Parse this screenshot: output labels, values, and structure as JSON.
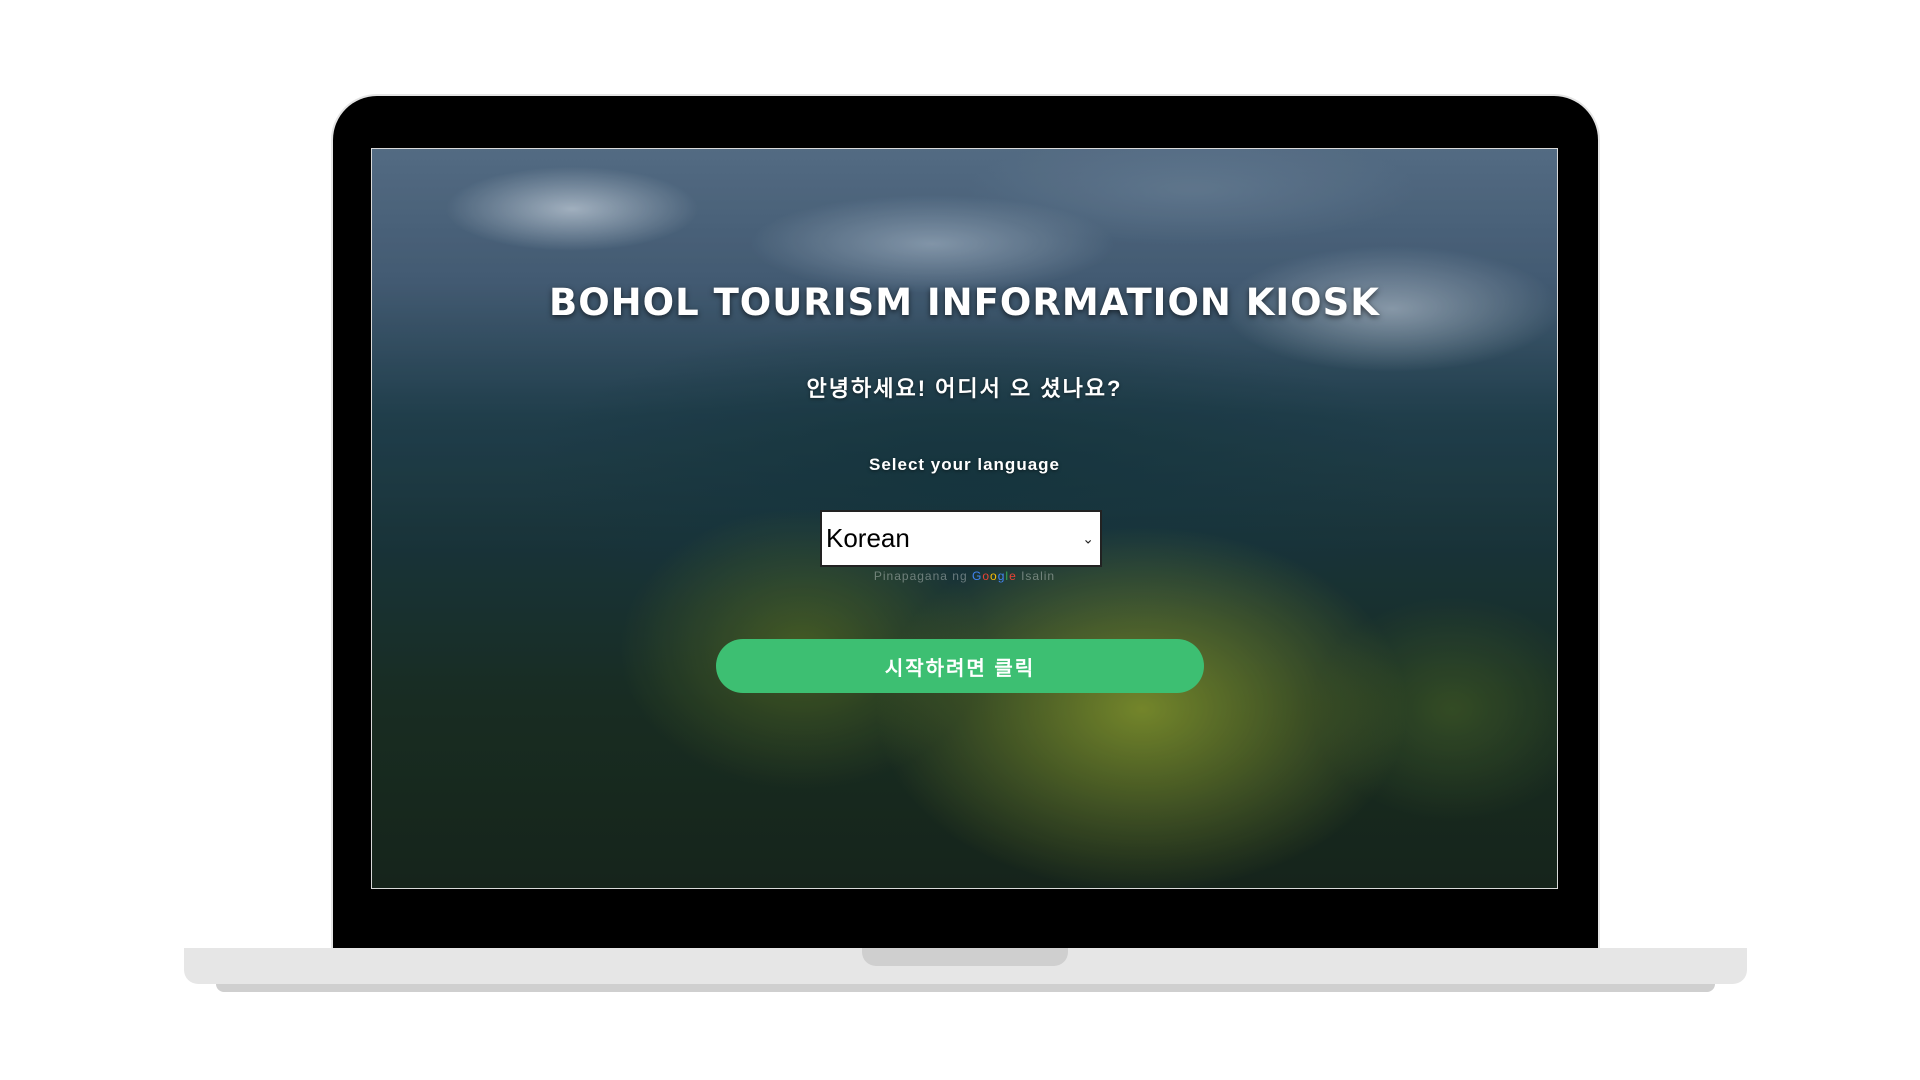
{
  "kiosk": {
    "title": "BOHOL TOURISM INFORMATION KIOSK",
    "greeting": "안녕하세요! 어디서 오 셨나요?",
    "select_label": "Select your language",
    "language": {
      "selected": "Korean"
    },
    "powered_by": {
      "prefix": "Pinapagana ng",
      "google_letters": [
        "G",
        "o",
        "o",
        "g",
        "l",
        "e"
      ],
      "suffix": "Isalin"
    },
    "start_button": "시작하려면 클릭"
  },
  "colors": {
    "accent_button": "#3dbf72",
    "laptop_frame": "#000000",
    "laptop_base": "#e6e6e6"
  },
  "icons": {
    "select_chevron": "chevron-down-icon"
  }
}
